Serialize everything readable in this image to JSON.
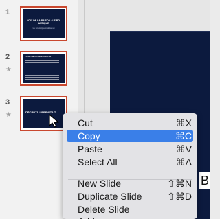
{
  "slides": [
    {
      "number": "1",
      "starred": false,
      "title": "VOIX DE LA RAISON : LE ROI ANTIQUE",
      "subtitle": "Le lorem ipsum dolor sit"
    },
    {
      "number": "2",
      "starred": true,
      "title": "TITRE DE LA DIAPOSITIVE",
      "subtitle": ""
    },
    {
      "number": "3",
      "starred": true,
      "title": "DÉCRUTS UPBRAITAIT",
      "subtitle": ""
    }
  ],
  "star_glyph": "★",
  "context_menu": {
    "items": [
      {
        "label": "Cut",
        "shortcut": "⌘X",
        "highlighted": false
      },
      {
        "label": "Copy",
        "shortcut": "⌘C",
        "highlighted": true
      },
      {
        "label": "Paste",
        "shortcut": "⌘V",
        "highlighted": false
      },
      {
        "label": "Select All",
        "shortcut": "⌘A",
        "highlighted": false
      },
      {
        "label": "New Slide",
        "shortcut": "⇧⌘N",
        "highlighted": false
      },
      {
        "label": "Duplicate Slide",
        "shortcut": "⇧⌘D",
        "highlighted": false
      },
      {
        "label": "Delete Slide",
        "shortcut": "",
        "highlighted": false
      },
      {
        "label": "Add Section",
        "shortcut": "",
        "highlighted": false
      }
    ]
  },
  "canvas_edge_text": "B",
  "canvas_edge_text2": "(",
  "colors": {
    "selection_border": "#c9482f",
    "slide_background": "#0c1a3e",
    "menu_highlight": "#3a7fe8"
  }
}
